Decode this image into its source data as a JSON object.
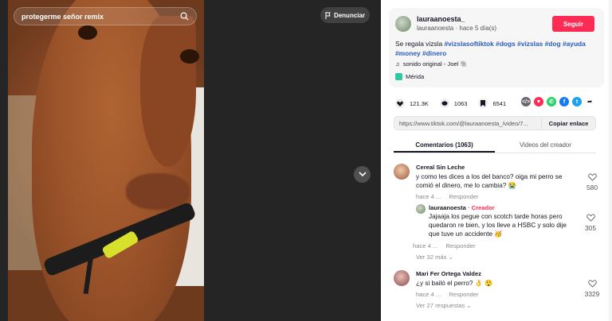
{
  "search": {
    "query": "protegerme señor remix"
  },
  "video": {
    "report_label": "Denunciar"
  },
  "author": {
    "username": "lauraanoesta_",
    "subline": "lauraanoesta · hace 5 día(s)",
    "follow_label": "Seguir"
  },
  "description": {
    "text": "Se regala vizsla ",
    "tags": [
      "#vizslasoftiktok",
      "#dogs",
      "#vizslas",
      "#dog",
      "#ayuda",
      "#money",
      "#dinero"
    ]
  },
  "sound": "sonido original - Joel 🐘",
  "location": "Mérida",
  "stats": {
    "likes": "121.3K",
    "comments": "1063",
    "saves": "6541"
  },
  "share_icons": [
    "embed-icon",
    "repost-icon",
    "whatsapp-icon",
    "facebook-icon",
    "twitter-icon",
    "share-arrow-icon"
  ],
  "colors": {
    "accent": "#fe2c55",
    "link": "#2b5db9",
    "whatsapp": "#25d366",
    "facebook": "#1877f2",
    "twitter": "#1da1f2"
  },
  "link": {
    "url": "https://www.tiktok.com/@lauraanoesta_/video/7...",
    "copy_label": "Copiar enlace"
  },
  "tabs": {
    "comments": "Comentarios (1063)",
    "creator_videos": "Videos del creador"
  },
  "comments": [
    {
      "name": "Cereal Sin Leche",
      "text": "y como les dices a los del banco? oiga mi perro se comió el dinero, me lo cambia? 😭",
      "time": "hace 4 ...",
      "reply_label": "Responder",
      "likes": "580"
    },
    {
      "name": "lauraanoesta",
      "creator_label": "· Creador",
      "text": "Jajaaja los pegue con scotch tarde horas pero quedaron re bien, y los lleve a HSBC y solo dije que tuve un accidente 🥳",
      "time": "hace 4 ...",
      "reply_label": "Responder",
      "likes": "305"
    },
    {
      "more": "Ver 32 más"
    },
    {
      "name": "Mari Fer Ortega Valdez",
      "text": "¿y si bailó el perro? 👌 😲",
      "time": "hace 4 ...",
      "reply_label": "Responder",
      "likes": "3329",
      "more": "Ver 27 respuestas"
    }
  ]
}
